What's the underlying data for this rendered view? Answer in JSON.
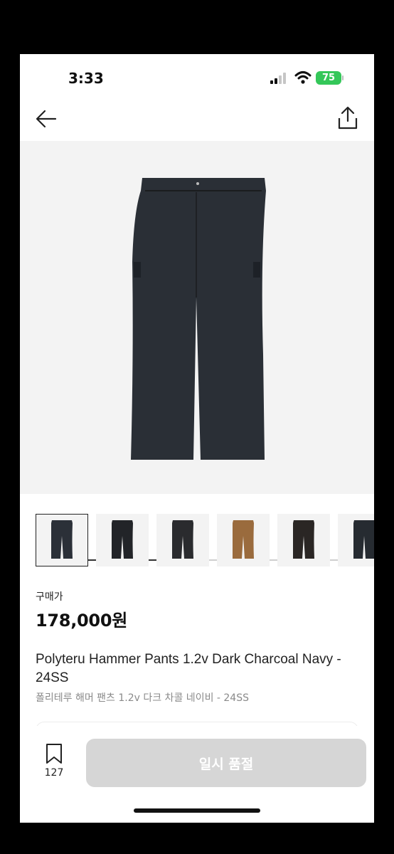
{
  "status_bar": {
    "time": "3:33",
    "battery": "75"
  },
  "product": {
    "price_label": "구매가",
    "price": "178,000원",
    "title_en": "Polyteru Hammer Pants 1.2v Dark Charcoal Navy - 24SS",
    "title_ko": "폴리테루 해머 팬츠 1.2v 다크 차콜 네이비 - 24SS",
    "main_color": "#2a2f36",
    "thumbnails": [
      {
        "color": "#2b3038",
        "selected": true
      },
      {
        "color": "#222428",
        "selected": false
      },
      {
        "color": "#2a2b2e",
        "selected": false
      },
      {
        "color": "#9a6b3d",
        "selected": false
      },
      {
        "color": "#2a2624",
        "selected": false
      },
      {
        "color": "#262b31",
        "selected": false
      }
    ],
    "image_progress": 0.5
  },
  "bottom_bar": {
    "bookmark_count": "127",
    "buy_label": "일시 품절"
  },
  "icons": {
    "back": "back-arrow-icon",
    "share": "share-icon",
    "bookmark": "bookmark-icon",
    "signal": "signal-icon",
    "wifi": "wifi-icon",
    "battery": "battery-icon"
  }
}
